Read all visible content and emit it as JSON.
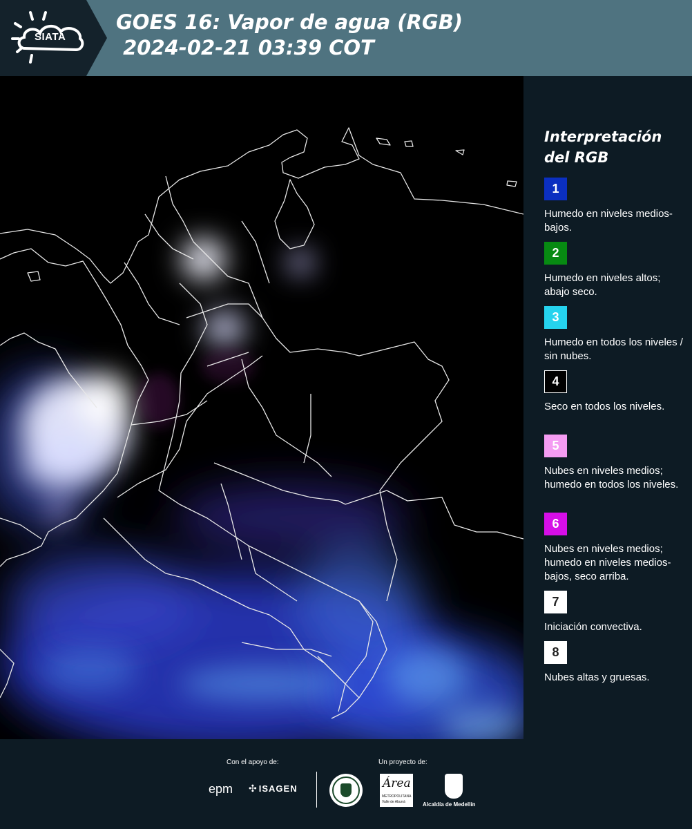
{
  "header": {
    "logo_text": "SIATA",
    "title_line1": "GOES 16: Vapor de agua (RGB)",
    "title_line2": " 2024-02-21 03:39 COT"
  },
  "legend": {
    "title_line1": "Interpretación",
    "title_line2": "del RGB",
    "items": [
      {
        "number": "1",
        "color": "#0b2fc0",
        "text_color": "#ffffff",
        "description": "Humedo en niveles medios-bajos."
      },
      {
        "number": "2",
        "color": "#078a12",
        "text_color": "#ffffff",
        "description": "Humedo en niveles altos; abajo seco."
      },
      {
        "number": "3",
        "color": "#25d3ee",
        "text_color": "#ffffff",
        "description": "Humedo en todos los niveles / sin nubes."
      },
      {
        "number": "4",
        "color": "#000000",
        "text_color": "#ffffff",
        "description": "Seco en todos los niveles."
      },
      {
        "number": "5",
        "color": "#f49cf2",
        "text_color": "#ffffff",
        "description": "Nubes en niveles medios; humedo en todos los niveles."
      },
      {
        "number": "6",
        "color": "#d60ee8",
        "text_color": "#ffffff",
        "description": "Nubes en niveles medios; humedo en niveles medios-bajos, seco arriba."
      },
      {
        "number": "7",
        "color": "#ffffff",
        "text_color": "#222222",
        "description": "Iniciación convectiva."
      },
      {
        "number": "8",
        "color": "#ffffff",
        "text_color": "#222222",
        "description": "Nubes altas y gruesas."
      }
    ]
  },
  "footer": {
    "support_label": "Con el apoyo de:",
    "project_label": "Un proyecto de:",
    "sponsors": [
      "epm",
      "ISAGEN"
    ],
    "partners": [
      "Área",
      "METROPOLITANA",
      "Valle de Aburrá",
      "Alcaldía de Medellín"
    ]
  }
}
